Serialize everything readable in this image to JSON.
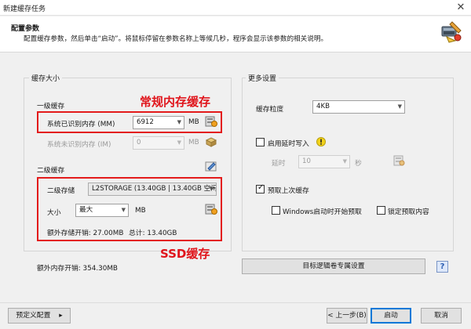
{
  "window": {
    "title": "新建缓存任务",
    "close_glyph": "✕"
  },
  "header": {
    "title": "配置参数",
    "description": "配置缓存参数，然后单击“启动”。将鼠标停留在参数名称上等候几秒，程序会显示该参数的相关说明。"
  },
  "cache_size": {
    "caption": "缓存大小",
    "level1": {
      "caption": "一级缓存",
      "recognized_label": "系统已识别内存 (MM)",
      "recognized_value": "6912",
      "recognized_unit": "MB",
      "unrecognized_label": "系统未识别内存 (IM)",
      "unrecognized_value": "0",
      "unrecognized_unit": "MB"
    },
    "level2": {
      "caption": "二级缓存",
      "storage_label": "二级存储",
      "storage_value": "L2STORAGE (13.40GB | 13.40GB 空闲)",
      "size_label": "大小",
      "size_value": "最大",
      "size_unit": "MB",
      "extra_storage": "额外存储开销: 27.00MB",
      "total": "总计: 13.40GB"
    },
    "extra_memory": "额外内存开销: 354.30MB"
  },
  "annotations": {
    "memory_cache": "常规内存缓存",
    "ssd_cache": "SSD缓存"
  },
  "more_settings": {
    "caption": "更多设置",
    "granularity_label": "缓存粒度",
    "granularity_value": "4KB",
    "defer_write_label": "启用延时写入",
    "defer_write_checked": false,
    "delay_label": "延时",
    "delay_value": "10",
    "delay_unit": "秒",
    "prefetch_label": "预取上次缓存",
    "prefetch_checked": true,
    "windows_prefetch_label": "Windows启动时开始预取",
    "windows_prefetch_checked": false,
    "lock_prefetch_label": "锁定预取内容",
    "lock_prefetch_checked": false,
    "volume_button": "目标逻辑卷专属设置",
    "help_glyph": "?"
  },
  "footer": {
    "preset_button": "预定义配置",
    "preset_arrow": "▸",
    "back_button": "< 上一步(B)",
    "start_button": "启动",
    "cancel_button": "取消"
  },
  "colors": {
    "annotation": "#e0141b",
    "accent": "#0078d7"
  }
}
